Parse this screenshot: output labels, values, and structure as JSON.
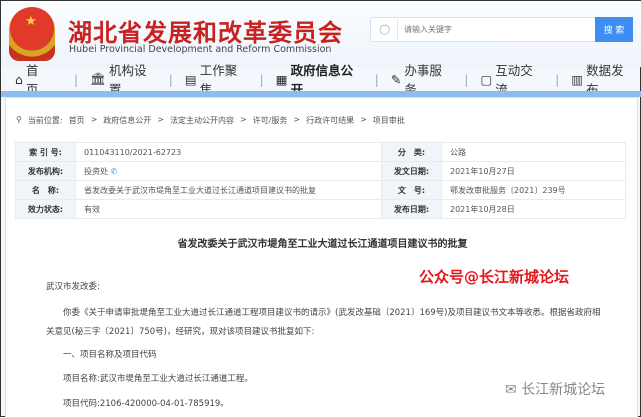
{
  "header": {
    "title": "湖北省发展和改革委员会",
    "subtitle": "Hubei Provincial Development and Reform Commission",
    "search_placeholder": "请输入关键字",
    "search_button": "搜 索"
  },
  "nav": [
    {
      "label": "首　页",
      "icon": "home-icon"
    },
    {
      "label": "机构设置",
      "icon": "institution-icon"
    },
    {
      "label": "工作聚焦",
      "icon": "document-icon"
    },
    {
      "label": "政府信息公开",
      "icon": "calendar-icon",
      "active": true
    },
    {
      "label": "办事服务",
      "icon": "edit-icon"
    },
    {
      "label": "互动交流",
      "icon": "chat-icon"
    },
    {
      "label": "数据发布",
      "icon": "chart-icon"
    }
  ],
  "breadcrumb": {
    "label": "当前位置:",
    "items": [
      "首页",
      "政府信息公开",
      "法定主动公开内容",
      "许可/服务",
      "行政许可结果",
      "项目审批"
    ]
  },
  "info": [
    {
      "l1": "索 引 号:",
      "v1": "011043110/2021-62723",
      "l2": "分　类:",
      "v2": "公路"
    },
    {
      "l1": "发布机构:",
      "v1": "投资处",
      "l2": "发文日期:",
      "v2": "2021年10月27日"
    },
    {
      "l1": "名　称:",
      "v1": "省发改委关于武汉市堤角至工业大道过长江通道项目建议书的批复",
      "l2": "文　号:",
      "v2": "鄂发改审批服务〔2021〕239号"
    },
    {
      "l1": "效力状态:",
      "v1": "有效",
      "l2": "发布日期:",
      "v2": "2021年10月28日"
    }
  ],
  "doc": {
    "title": "省发改委关于武汉市堤角至工业大道过长江通道项目建议书的批复",
    "salutation": "武汉市发改委:",
    "para1": "你委《关于申请审批堤角至工业大道过长江通道工程项目建议书的请示》(武发改基础〔2021〕169号)及项目建议书文本等收悉。根据省政府相",
    "para1b": "关意见(秘三字〔2021〕750号)，经研究，现对该项目建议书批复如下:",
    "section1": "一、项目名称及项目代码",
    "name": "项目名称:武汉市堤角至工业大道过长江通道工程。",
    "code": "项目代码:2106-420000-04-01-785919。"
  },
  "watermarks": {
    "top": "公众号@长江新城论坛",
    "bottom": "长江新城论坛"
  }
}
